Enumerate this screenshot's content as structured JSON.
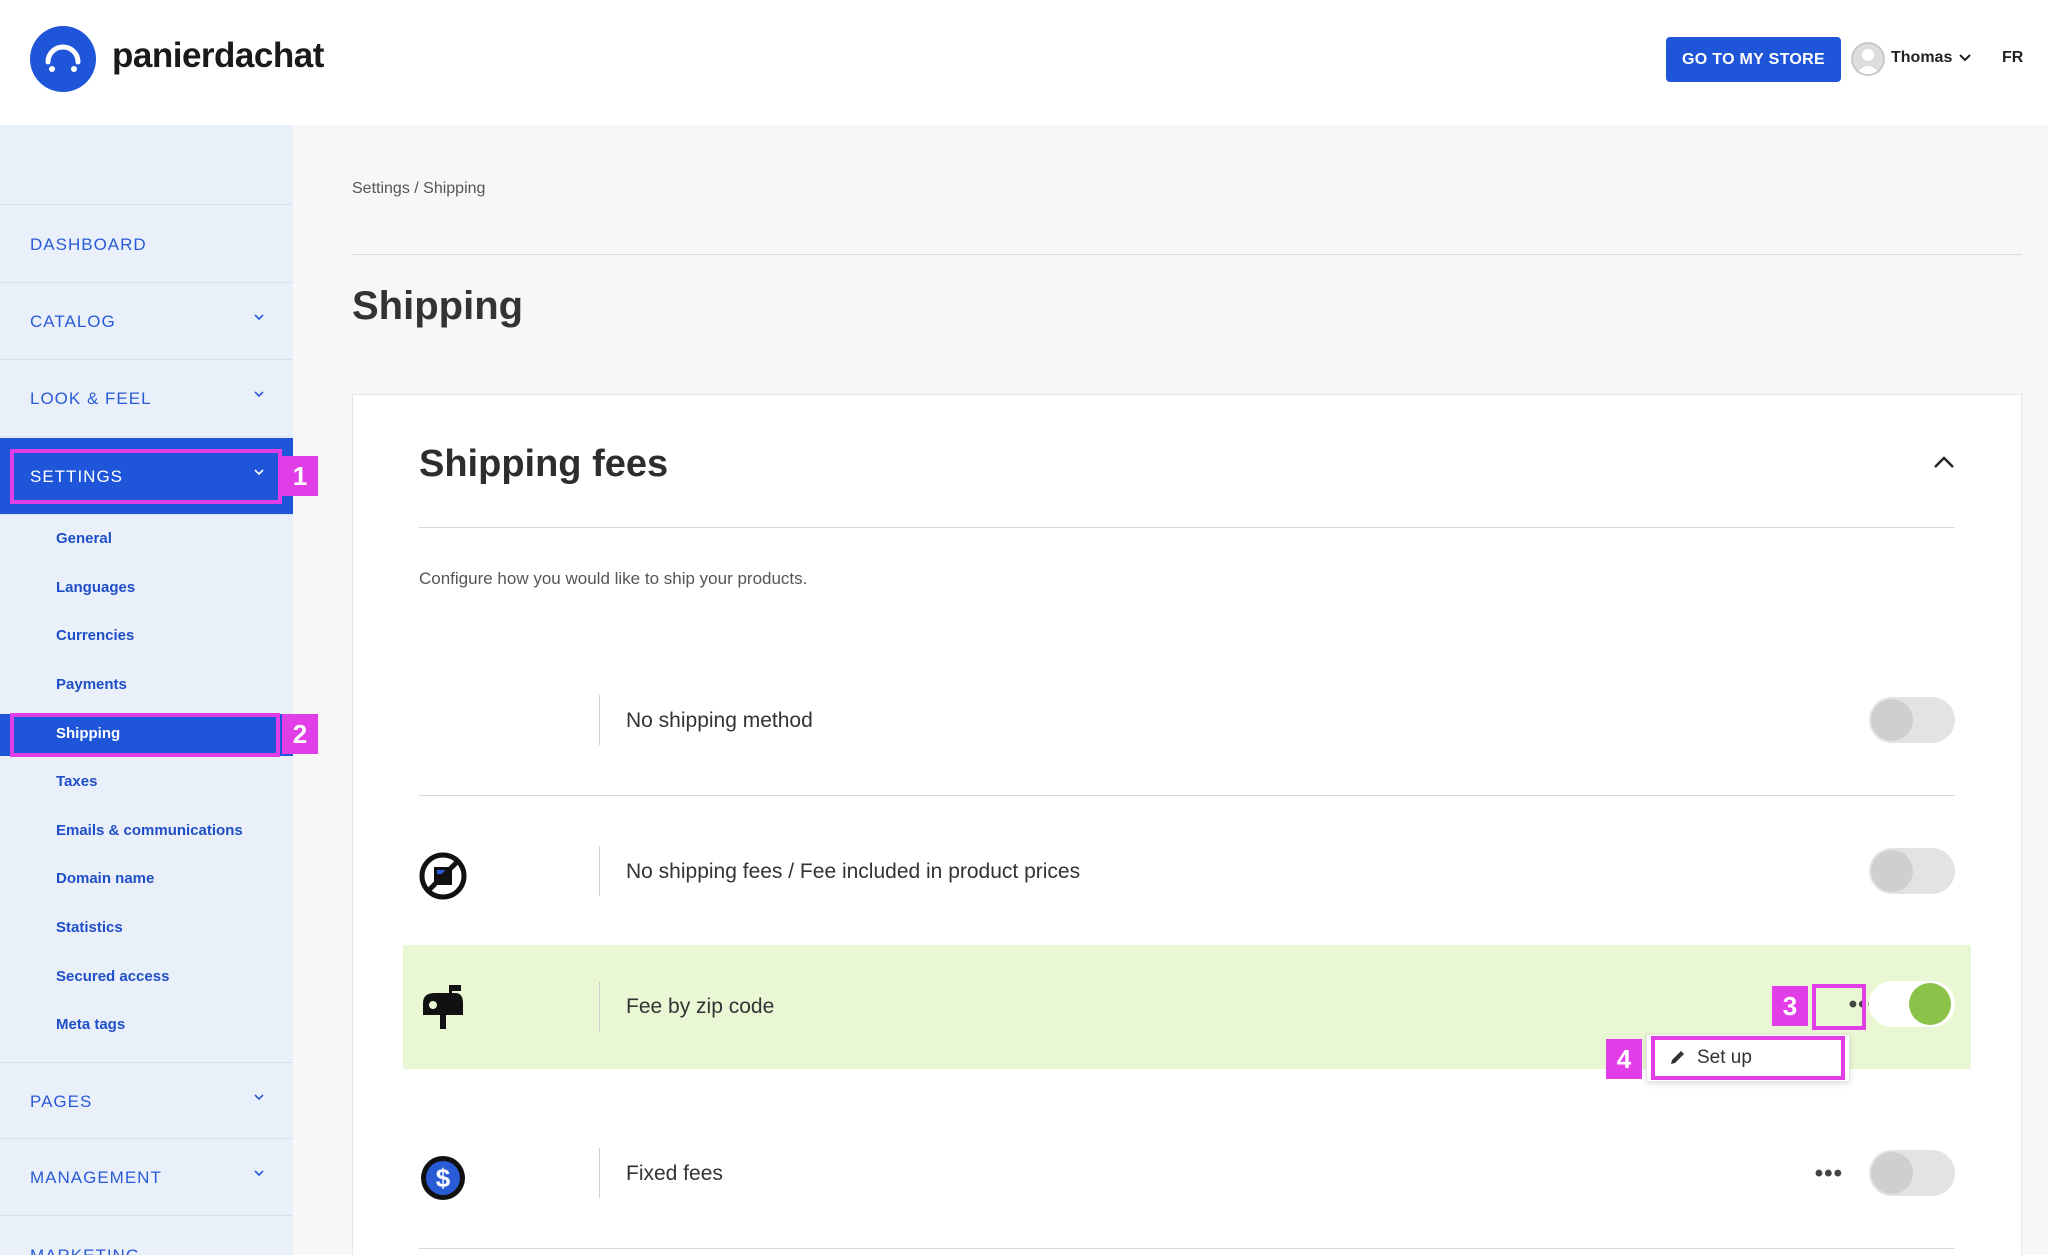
{
  "header": {
    "brand": "panierdachat",
    "store_button": "GO TO MY STORE",
    "user": "Thomas",
    "language": "FR"
  },
  "sidebar": {
    "items": [
      {
        "label": "DASHBOARD",
        "has_chevron": false
      },
      {
        "label": "CATALOG",
        "has_chevron": true
      },
      {
        "label": "LOOK & FEEL",
        "has_chevron": true
      },
      {
        "label": "SETTINGS",
        "has_chevron": true,
        "active": true
      }
    ],
    "subitems": [
      "General",
      "Languages",
      "Currencies",
      "Payments",
      "Shipping",
      "Taxes",
      "Emails & communications",
      "Domain name",
      "Statistics",
      "Secured access",
      "Meta tags"
    ],
    "active_subitem": "Shipping",
    "bottom_items": [
      {
        "label": "PAGES",
        "has_chevron": true
      },
      {
        "label": "MANAGEMENT",
        "has_chevron": true
      },
      {
        "label": "MARKETING",
        "has_chevron": false
      }
    ]
  },
  "breadcrumb": "Settings / Shipping",
  "page_title": "Shipping",
  "card": {
    "title": "Shipping fees",
    "description": "Configure how you would like to ship your products.",
    "rows": [
      {
        "label": "No shipping method",
        "icon": "none",
        "enabled": false,
        "menu": false
      },
      {
        "label": "No shipping fees / Fee included in product prices",
        "icon": "no-fee-icon",
        "enabled": false,
        "menu": false
      },
      {
        "label": "Fee by zip code",
        "icon": "mailbox-icon",
        "enabled": true,
        "menu": true
      },
      {
        "label": "Fixed fees",
        "icon": "dollar-coin-icon",
        "enabled": false,
        "menu": true
      }
    ],
    "menu_option": "Set up",
    "dots": "•••"
  },
  "annotations": [
    "1",
    "2",
    "3",
    "4"
  ],
  "colors": {
    "accent": "#1f55d9",
    "highlight": "#e23ee8",
    "active_row": "#e9f7d4",
    "toggle_on": "#8bc24a"
  }
}
